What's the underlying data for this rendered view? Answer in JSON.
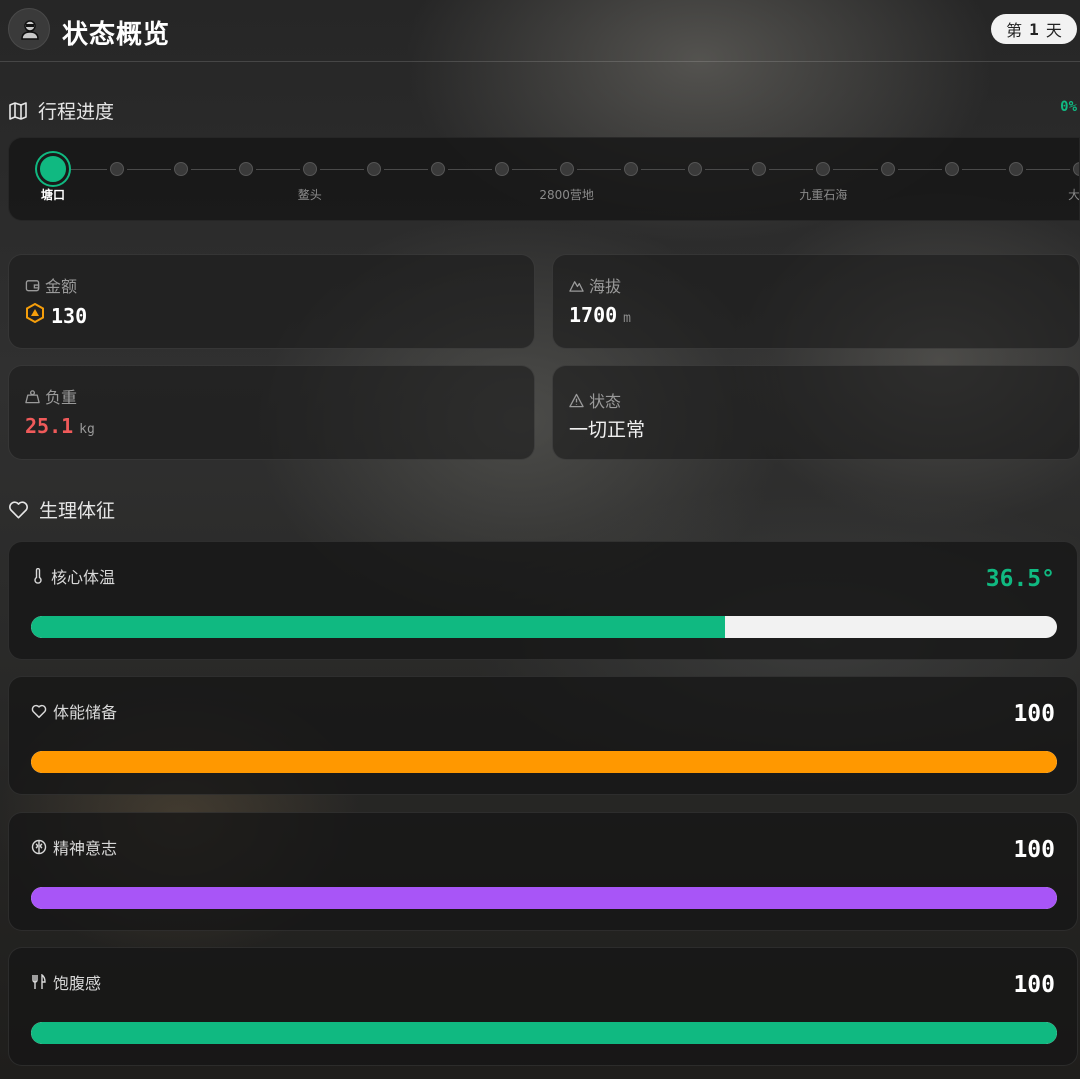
{
  "header": {
    "title": "状态概览",
    "day_prefix": "第",
    "day_number": "1",
    "day_suffix": "天"
  },
  "journey": {
    "title": "行程进度",
    "progress_text": "0%",
    "progress": 0,
    "current_index": 0,
    "labels": [
      {
        "index": 0,
        "text": "塘口"
      },
      {
        "index": 4,
        "text": "鳌头"
      },
      {
        "index": 8,
        "text": "2800营地"
      },
      {
        "index": 12,
        "text": "九重石海"
      },
      {
        "index": 16,
        "text": "大文"
      }
    ],
    "node_count": 17
  },
  "stats": {
    "money": {
      "label": "金额",
      "value": "130",
      "icon": "wallet-icon",
      "value_icon": "coin-icon"
    },
    "altitude": {
      "label": "海拔",
      "value": "1700",
      "unit": "m",
      "icon": "mountain-icon"
    },
    "load": {
      "label": "负重",
      "value": "25.1",
      "unit": "kg",
      "icon": "weight-icon"
    },
    "status": {
      "label": "状态",
      "value": "一切正常",
      "icon": "alert-triangle-icon"
    }
  },
  "vitals": {
    "title": "生理体征",
    "items": [
      {
        "label": "核心体温",
        "value": "36.5°",
        "level": 0.676,
        "color": "#10b981",
        "value_color": "#10b981",
        "icon": "thermometer-icon"
      },
      {
        "label": "体能储备",
        "value": "100",
        "level": 1.0,
        "color": "#ff9800",
        "value_color": "#ffffff",
        "icon": "heart-icon"
      },
      {
        "label": "精神意志",
        "value": "100",
        "level": 1.0,
        "color": "#a855f7",
        "value_color": "#ffffff",
        "icon": "brain-icon"
      },
      {
        "label": "饱腹感",
        "value": "100",
        "level": 1.0,
        "color": "#10b981",
        "value_color": "#ffffff",
        "icon": "utensils-icon"
      }
    ]
  },
  "colors": {
    "accent_green": "#10b981",
    "danger_red": "#f05a5a",
    "coin_orange": "#f59e0b"
  }
}
